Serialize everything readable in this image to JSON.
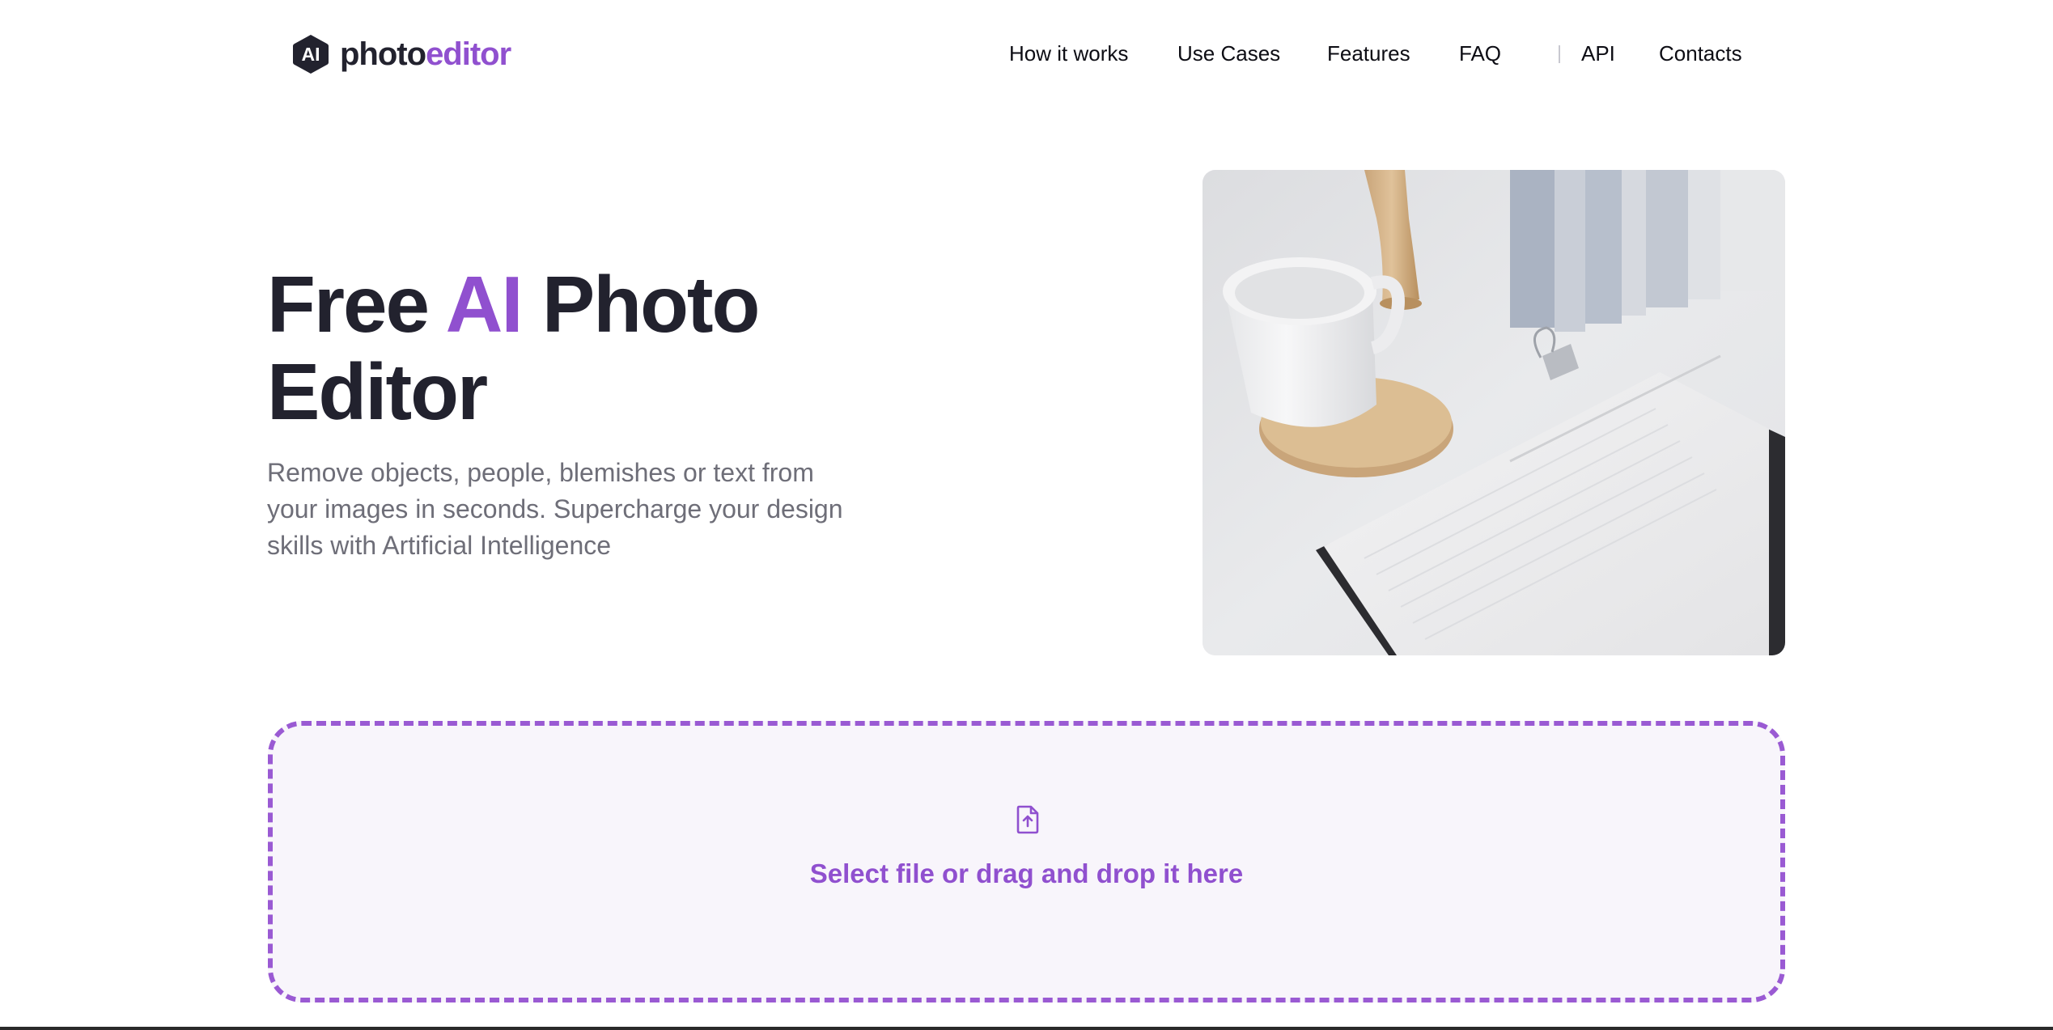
{
  "header": {
    "logo": {
      "mark_text": "AI",
      "name_part1": "photo",
      "name_part2": "editor"
    },
    "nav": [
      {
        "label": "How it works"
      },
      {
        "label": "Use Cases"
      },
      {
        "label": "Features"
      },
      {
        "label": "FAQ"
      },
      {
        "label": "API"
      },
      {
        "label": "Contacts"
      }
    ]
  },
  "hero": {
    "title_part1": "Free ",
    "title_accent": "AI",
    "title_part2": " Photo Editor",
    "subtitle": "Remove objects, people, blemishes or text from your images in seconds. Supercharge your design skills with Artificial Intelligence",
    "image_icon": "desk-photo"
  },
  "upload": {
    "icon": "file-upload-icon",
    "text": "Select file or drag and drop it here"
  },
  "colors": {
    "accent": "#9050cf",
    "text_dark": "#22222e",
    "text_muted": "#6e6e78",
    "dropzone_bg": "#f8f5fb",
    "dropzone_border": "#9a5ad3"
  }
}
